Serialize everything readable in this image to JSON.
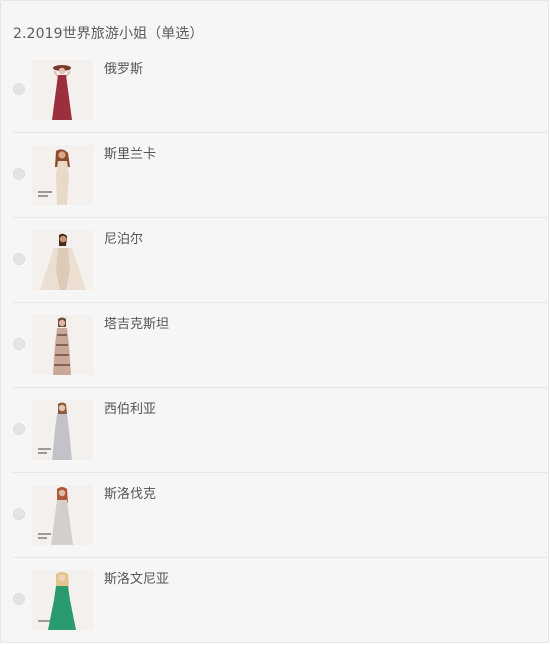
{
  "question": {
    "title": "2.2019世界旅游小姐（单选）"
  },
  "options": [
    {
      "label": "俄罗斯",
      "dress_color": "#9c2f3e",
      "skin_color": "#e2bfae"
    },
    {
      "label": "斯里兰卡",
      "dress_color": "#e9d9c8",
      "skin_color": "#d9a68a"
    },
    {
      "label": "尼泊尔",
      "dress_color": "#eadfd1",
      "skin_color": "#c8957c"
    },
    {
      "label": "塔吉克斯坦",
      "dress_color": "#c9a89a",
      "skin_color": "#dcb8a6"
    },
    {
      "label": "西伯利亚",
      "dress_color": "#c3c2c8",
      "skin_color": "#e3c4b1"
    },
    {
      "label": "斯洛伐克",
      "dress_color": "#d3cfcc",
      "skin_color": "#e0bda8"
    },
    {
      "label": "斯洛文尼亚",
      "dress_color": "#2a9a6f",
      "skin_color": "#ecd2bf"
    }
  ]
}
